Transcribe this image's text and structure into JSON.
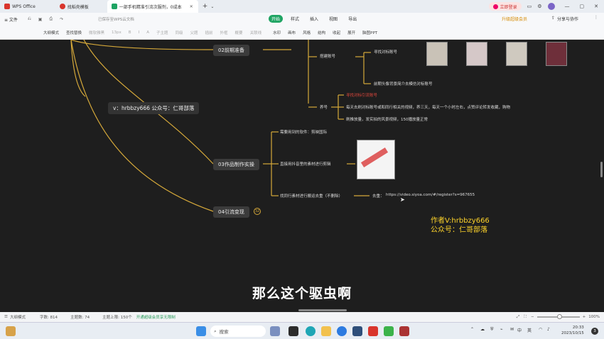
{
  "titlebar": {
    "tabs": [
      {
        "label": "WPS Office",
        "color": "#d9352c"
      },
      {
        "label": "找稻壳模板",
        "color": "#d9352c"
      },
      {
        "label": "一部手机精准引流次服剂，0成本",
        "color": "#1fa463"
      }
    ],
    "new_tab": "+",
    "login_button": "立即登录"
  },
  "menubar": {
    "file": "≡ 文件",
    "items": [
      "开始",
      "样式",
      "插入",
      "视图",
      "导出"
    ],
    "active": "开始",
    "upgrade": "升级超级会员",
    "share": "分享与协作"
  },
  "toolbar": {
    "items": [
      {
        "label": "大纲模式",
        "disabled": false
      },
      {
        "label": "查找替换",
        "disabled": false
      },
      {
        "label": "微软雅黑",
        "disabled": true
      },
      {
        "label": "13px",
        "disabled": true
      },
      {
        "label": "B",
        "disabled": true
      },
      {
        "label": "I",
        "disabled": true
      },
      {
        "label": "A",
        "disabled": true
      },
      {
        "label": "子主题",
        "disabled": true
      },
      {
        "label": "同级",
        "disabled": true
      },
      {
        "label": "父题",
        "disabled": true
      },
      {
        "label": "插前",
        "disabled": true
      },
      {
        "label": "外框",
        "disabled": true
      },
      {
        "label": "概要",
        "disabled": true
      },
      {
        "label": "关联线",
        "disabled": true
      },
      {
        "label": "水印",
        "disabled": false
      },
      {
        "label": "画布",
        "disabled": false
      },
      {
        "label": "风格",
        "disabled": false
      },
      {
        "label": "结构",
        "disabled": false
      },
      {
        "label": "收起",
        "disabled": false
      },
      {
        "label": "展开",
        "disabled": false
      },
      {
        "label": "脑图PPT",
        "disabled": false
      }
    ],
    "save_hint": "已保存至WPS云文档"
  },
  "mindmap": {
    "nodes": {
      "n02": "02前期准备",
      "n03": "03作品制作实操",
      "n04": "04引流变现",
      "contact": "v：hrbbzy666  公众号：仁哥部落"
    },
    "badge_04": "32",
    "leaves": {
      "build_account": "搭建账号",
      "find_target": "寻找对标账号",
      "modify_profile": "前期头像背景简介去模仿对标账号",
      "nurture": "养号",
      "nurture_red": "寻找对标引流账号",
      "nurture_1": "每天去刷对标账号或和同行相关的视频，养三天，每天一个小时左右，点赞评论转发收藏，购物",
      "nurture_2": "刷推放量，发实拍的风景视频，150播放量正常",
      "software": "需要用到的软件：剪映国际",
      "edit_footage": "直接用抖音里的素材进行剪辑",
      "find_material": "找同行素材进行搬运去重（不删除）",
      "dedup_label": "去重：",
      "dedup_url": "https://video.siyoa.com/#/register?s=967655"
    },
    "watermark": {
      "line1": "作者V:hrbbzy666",
      "line2": "公众号：仁哥部落"
    },
    "subtitle": "那么这个驱虫啊",
    "colors": {
      "branch": "#d6a93a",
      "subtitle": "#ffffff",
      "watermark": "#ffd42a",
      "red_text": "#e0473c"
    }
  },
  "statusbar": {
    "mode": "大纲模式",
    "word_count": "字数: 814",
    "topic_count": "主题数: 74",
    "topic_limit": "主题上限: 150个",
    "upgrade_hint": "开通超级会员享无限制",
    "zoom": "100%"
  },
  "taskbar": {
    "search_placeholder": "搜索",
    "ime_mode": "英",
    "ime_zh": "中",
    "time": "20:33",
    "date": "2023/10/15",
    "notification_count": "3"
  }
}
